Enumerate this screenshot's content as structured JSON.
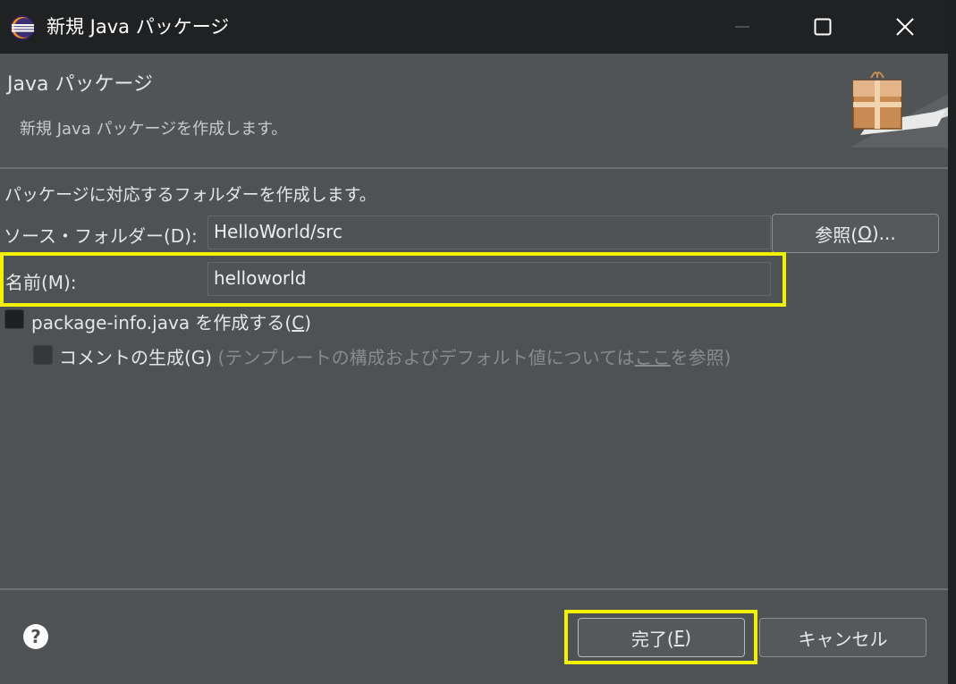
{
  "window": {
    "title": "新規 Java パッケージ",
    "minimize_icon": "minimize-icon",
    "maximize_icon": "maximize-icon",
    "close_icon": "close-icon"
  },
  "header": {
    "title": "Java パッケージ",
    "description": "新規 Java パッケージを作成します。",
    "image_icon": "package-wizard-icon"
  },
  "body": {
    "description": "パッケージに対応するフォルダーを作成します。",
    "source_folder": {
      "label": "ソース・フォルダー(D):",
      "value": "HelloWorld/src",
      "browse_label_prefix": "参照(",
      "browse_mnemonic": "O",
      "browse_label_suffix": ")..."
    },
    "name": {
      "label": "名前(M):",
      "value": "helloworld"
    },
    "package_info": {
      "label_prefix": "package-info.java を作成する(",
      "mnemonic": "C",
      "label_suffix": ")",
      "checked": false
    },
    "comments": {
      "label": "コメントの生成(G)",
      "hint_prefix": "(テンプレートの構成およびデフォルト値については",
      "hint_link": "ここ",
      "hint_suffix": "を参照)",
      "checked": false,
      "enabled": false
    }
  },
  "footer": {
    "help_icon": "help-icon",
    "finish_prefix": "完了(",
    "finish_mnemonic": "F",
    "finish_suffix": ")",
    "cancel_label": "キャンセル"
  },
  "colors": {
    "highlight": "#f2f200",
    "background": "#4e5254",
    "titlebar": "#202122"
  }
}
